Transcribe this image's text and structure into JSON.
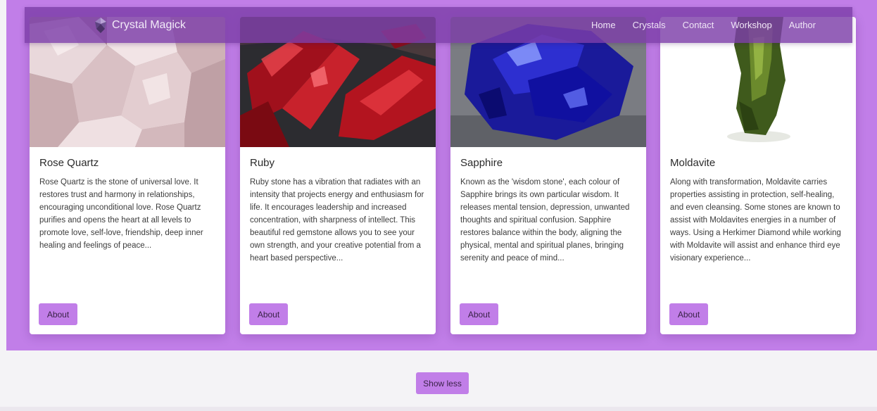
{
  "navbar": {
    "brand": "Crystal Magick",
    "brand_icon": "crystal-icon",
    "links": [
      "Home",
      "Crystals",
      "Contact",
      "Workshop",
      "Author"
    ]
  },
  "cards": [
    {
      "title": "Rose Quartz",
      "image": "rose-quartz-photo",
      "description": "Rose Quartz is the stone of universal love. It restores trust and harmony in relationships, encouraging unconditional love. Rose Quartz purifies and opens the heart at all levels to promote love, self-love, friendship, deep inner healing and feelings of peace...",
      "button": "About"
    },
    {
      "title": "Ruby",
      "image": "ruby-photo",
      "description": "Ruby stone has a vibration that radiates with an intensity that projects energy and enthusiasm for life. It encourages leadership and increased concentration, with sharpness of intellect. This beautiful red gemstone allows you to see your own strength, and your creative potential from a heart based perspective...",
      "button": "About"
    },
    {
      "title": "Sapphire",
      "image": "sapphire-photo",
      "description": "Known as the 'wisdom stone', each colour of Sapphire brings its own particular wisdom. It releases mental tension, depression, unwanted thoughts and spiritual confusion. Sapphire restores balance within the body, aligning the physical, mental and spiritual planes, bringing serenity and peace of mind...",
      "button": "About"
    },
    {
      "title": "Moldavite",
      "image": "moldavite-photo",
      "description": "Along with transformation, Moldavite carries properties assisting in protection, self-healing, and even cleansing. Some stones are known to assist with Moldavites energies in a number of ways. Using a Herkimer Diamond while working with Moldavite will assist and enhance third eye visionary experience...",
      "button": "About"
    }
  ],
  "show_less": "Show less",
  "colors": {
    "accent": "#c17ee8",
    "navbar": "#7c3ea8",
    "background": "#f4f3f6"
  }
}
